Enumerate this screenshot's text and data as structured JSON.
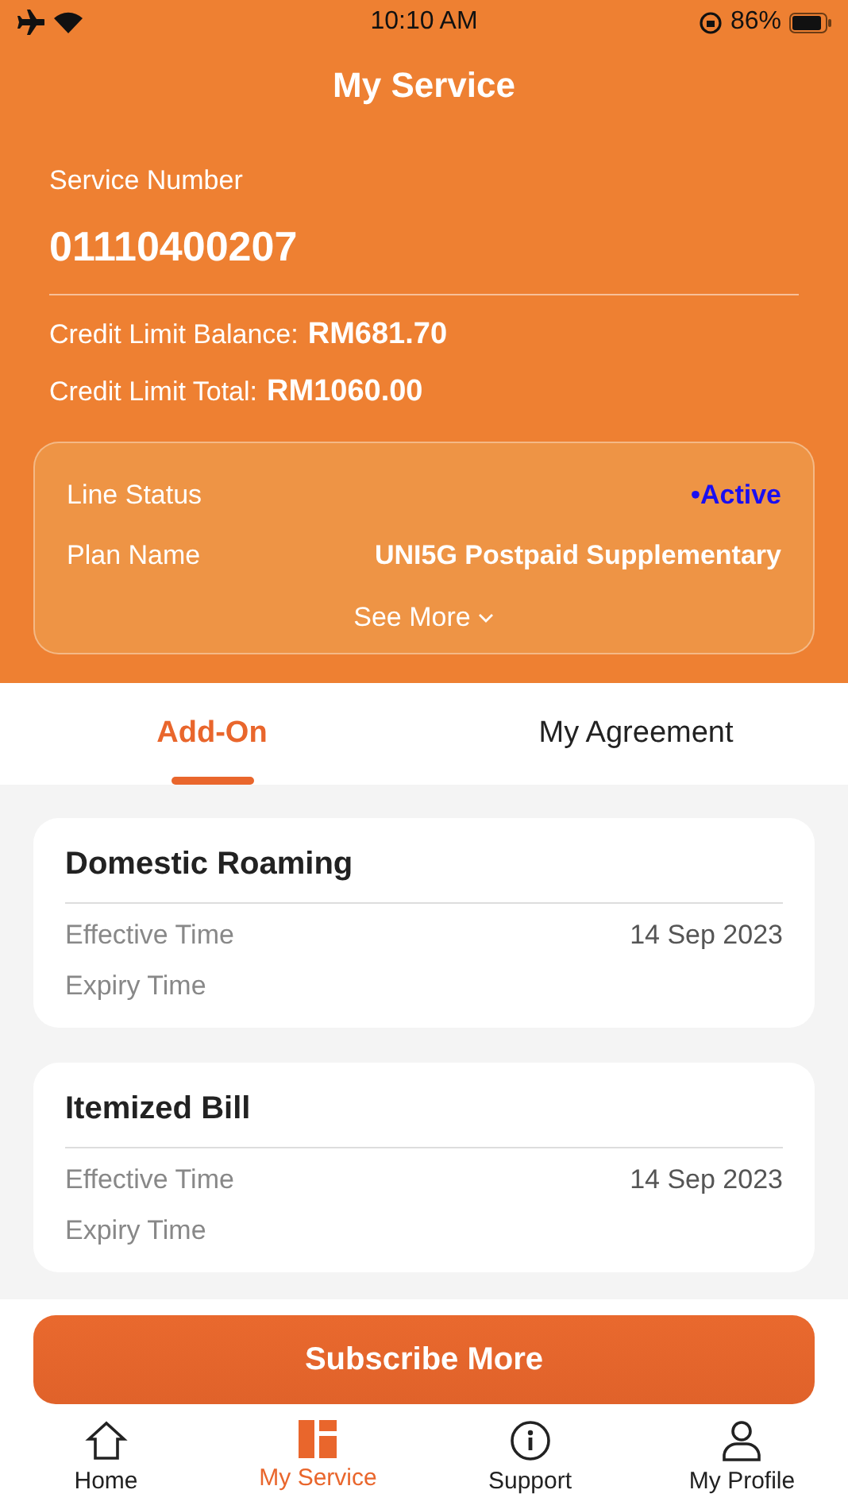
{
  "status_bar": {
    "time": "10:10 AM",
    "battery": "86%"
  },
  "title": "My Service",
  "service": {
    "label": "Service Number",
    "number": "01110400207"
  },
  "credit": [
    {
      "label": "Credit Limit Balance:",
      "value": "RM681.70"
    },
    {
      "label": "Credit Limit Total:",
      "value": "RM1060.00"
    }
  ],
  "line_info": {
    "rows": [
      {
        "label": "Line Status",
        "value": "•Active",
        "kind": "status",
        "color": "#1a0ff0"
      },
      {
        "label": "Plan Name",
        "value": "UNI5G Postpaid Supplementary",
        "kind": "text"
      }
    ],
    "see_more": "See More"
  },
  "tabs": [
    {
      "label": "Add-On",
      "selected": true
    },
    {
      "label": "My Agreement",
      "selected": false
    }
  ],
  "addons": [
    {
      "name": "Domestic Roaming",
      "rows": [
        {
          "label": "Effective Time",
          "value": "14 Sep 2023"
        },
        {
          "label": "Expiry Time"
        }
      ]
    },
    {
      "name": "Itemized Bill",
      "rows": [
        {
          "label": "Effective Time",
          "value": "14 Sep 2023"
        },
        {
          "label": "Expiry Time"
        }
      ]
    }
  ],
  "subscribe_button": "Subscribe More",
  "nav": [
    {
      "label": "Home",
      "kind": "home",
      "selected": false
    },
    {
      "label": "My Service",
      "kind": "service",
      "selected": true
    },
    {
      "label": "Support",
      "kind": "support",
      "selected": false
    },
    {
      "label": "My Profile",
      "kind": "profile",
      "selected": false
    }
  ]
}
